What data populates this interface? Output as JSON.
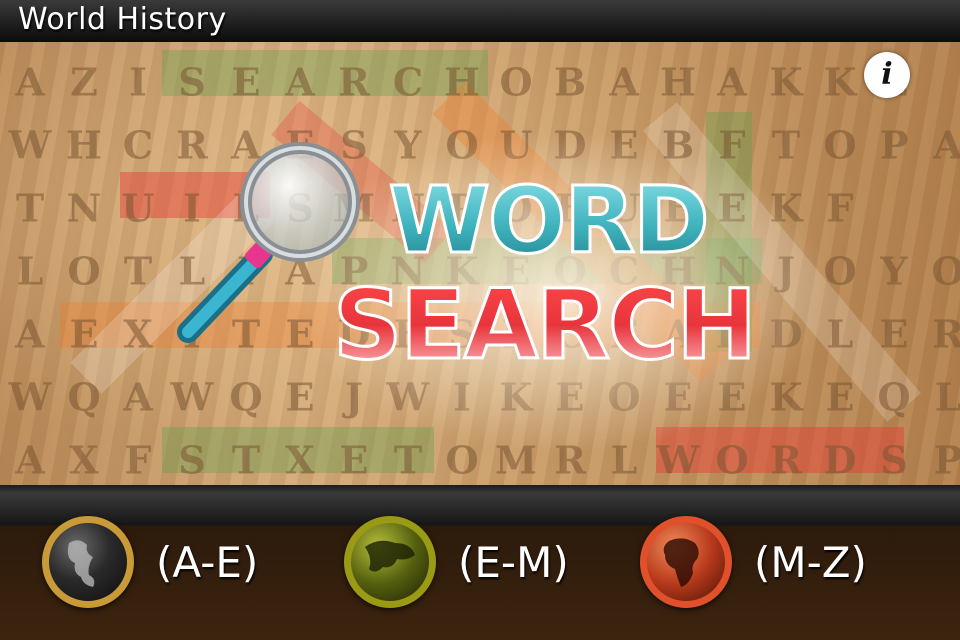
{
  "title_bar": {
    "title": "World History"
  },
  "board": {
    "rows": [
      "AZISEARCHOBAHAKKE",
      "WHCRAESYOUDEBFTOPA",
      "TNUILSMNPOEUEEKF",
      "LOTLIAPNKEOCHNJOYO",
      "AEXITEDESECEADDLER",
      "WQAWQEJWIKEOEEKEQL",
      "AXFSTXETOMRLWORDSP"
    ]
  },
  "info_button": {
    "label": "i",
    "icon": "info-icon"
  },
  "logo": {
    "line1": "WORD",
    "line2": "SEARCH",
    "icon": "magnifier-icon"
  },
  "ranges": [
    {
      "label": "(A-E)",
      "icon": "globe-americas-icon",
      "ring": "#c89a38",
      "fill": "#2a2a2a"
    },
    {
      "label": "(E-M)",
      "icon": "globe-asia-icon",
      "ring": "#9a9a14",
      "fill": "#56600f"
    },
    {
      "label": "(M-Z)",
      "icon": "globe-africa-icon",
      "ring": "#e0502a",
      "fill": "#b83a1c"
    }
  ],
  "colors": {
    "word_teal": "#3fb3bd",
    "search_red": "#e8343c",
    "highlight_green": "#5aa04a",
    "highlight_orange": "#f07a2a",
    "highlight_red": "#e83a36"
  }
}
